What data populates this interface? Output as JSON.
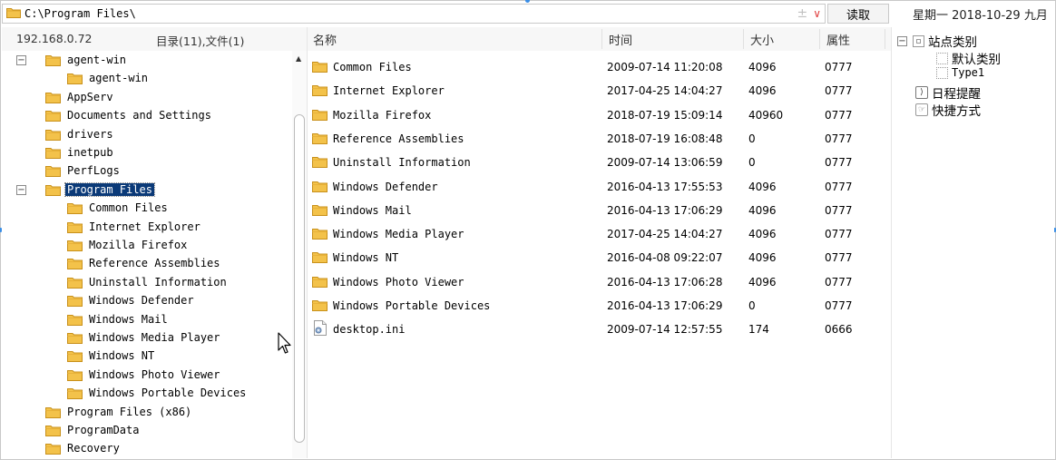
{
  "path_bar": {
    "path": "C:\\Program Files\\",
    "read_button": "读取"
  },
  "date_text": "星期一  2018-10-29  九月",
  "left_panel": {
    "host": "192.168.0.72",
    "counts": "目录(11),文件(1)",
    "tree": [
      {
        "label": "agent-win",
        "level": 1,
        "expander": "−"
      },
      {
        "label": "agent-win",
        "level": 2
      },
      {
        "label": "AppServ",
        "level": 1
      },
      {
        "label": "Documents and Settings",
        "level": 1
      },
      {
        "label": "drivers",
        "level": 1
      },
      {
        "label": "inetpub",
        "level": 1
      },
      {
        "label": "PerfLogs",
        "level": 1
      },
      {
        "label": "Program Files",
        "level": 1,
        "expander": "−",
        "selected": true,
        "open": true
      },
      {
        "label": "Common Files",
        "level": 2
      },
      {
        "label": "Internet Explorer",
        "level": 2
      },
      {
        "label": "Mozilla Firefox",
        "level": 2
      },
      {
        "label": "Reference Assemblies",
        "level": 2
      },
      {
        "label": "Uninstall Information",
        "level": 2
      },
      {
        "label": "Windows Defender",
        "level": 2
      },
      {
        "label": "Windows Mail",
        "level": 2
      },
      {
        "label": "Windows Media Player",
        "level": 2
      },
      {
        "label": "Windows NT",
        "level": 2
      },
      {
        "label": "Windows Photo Viewer",
        "level": 2
      },
      {
        "label": "Windows Portable Devices",
        "level": 2
      },
      {
        "label": "Program Files (x86)",
        "level": 1
      },
      {
        "label": "ProgramData",
        "level": 1
      },
      {
        "label": "Recovery",
        "level": 1
      }
    ]
  },
  "file_list": {
    "columns": {
      "name": "名称",
      "time": "时间",
      "size": "大小",
      "attr": "属性"
    },
    "rows": [
      {
        "name": "Common Files",
        "time": "2009-07-14 11:20:08",
        "size": "4096",
        "attr": "0777",
        "type": "folder"
      },
      {
        "name": "Internet Explorer",
        "time": "2017-04-25 14:04:27",
        "size": "4096",
        "attr": "0777",
        "type": "folder"
      },
      {
        "name": "Mozilla Firefox",
        "time": "2018-07-19 15:09:14",
        "size": "40960",
        "attr": "0777",
        "type": "folder"
      },
      {
        "name": "Reference Assemblies",
        "time": "2018-07-19 16:08:48",
        "size": "0",
        "attr": "0777",
        "type": "folder"
      },
      {
        "name": "Uninstall Information",
        "time": "2009-07-14 13:06:59",
        "size": "0",
        "attr": "0777",
        "type": "folder"
      },
      {
        "name": "Windows Defender",
        "time": "2016-04-13 17:55:53",
        "size": "4096",
        "attr": "0777",
        "type": "folder"
      },
      {
        "name": "Windows Mail",
        "time": "2016-04-13 17:06:29",
        "size": "4096",
        "attr": "0777",
        "type": "folder"
      },
      {
        "name": "Windows Media Player",
        "time": "2017-04-25 14:04:27",
        "size": "4096",
        "attr": "0777",
        "type": "folder"
      },
      {
        "name": "Windows NT",
        "time": "2016-04-08 09:22:07",
        "size": "4096",
        "attr": "0777",
        "type": "folder"
      },
      {
        "name": "Windows Photo Viewer",
        "time": "2016-04-13 17:06:28",
        "size": "4096",
        "attr": "0777",
        "type": "folder"
      },
      {
        "name": "Windows Portable Devices",
        "time": "2016-04-13 17:06:29",
        "size": "0",
        "attr": "0777",
        "type": "folder"
      },
      {
        "name": "desktop.ini",
        "time": "2009-07-14 12:57:55",
        "size": "174",
        "attr": "0666",
        "type": "file"
      }
    ]
  },
  "right_panel": {
    "site_category": "站点类别",
    "default_category": "默认类别",
    "type1": "Type1",
    "schedule": "日程提醒",
    "shortcut": "快捷方式"
  },
  "colors": {
    "folder": "#f3c24a",
    "folder_edge": "#c8901a",
    "selection": "#0b3a78",
    "handle": "#3a8ee6"
  },
  "icons": {
    "folder": "folder-icon",
    "file": "settings-file-icon",
    "cursor": "mouse-pointer-icon"
  }
}
